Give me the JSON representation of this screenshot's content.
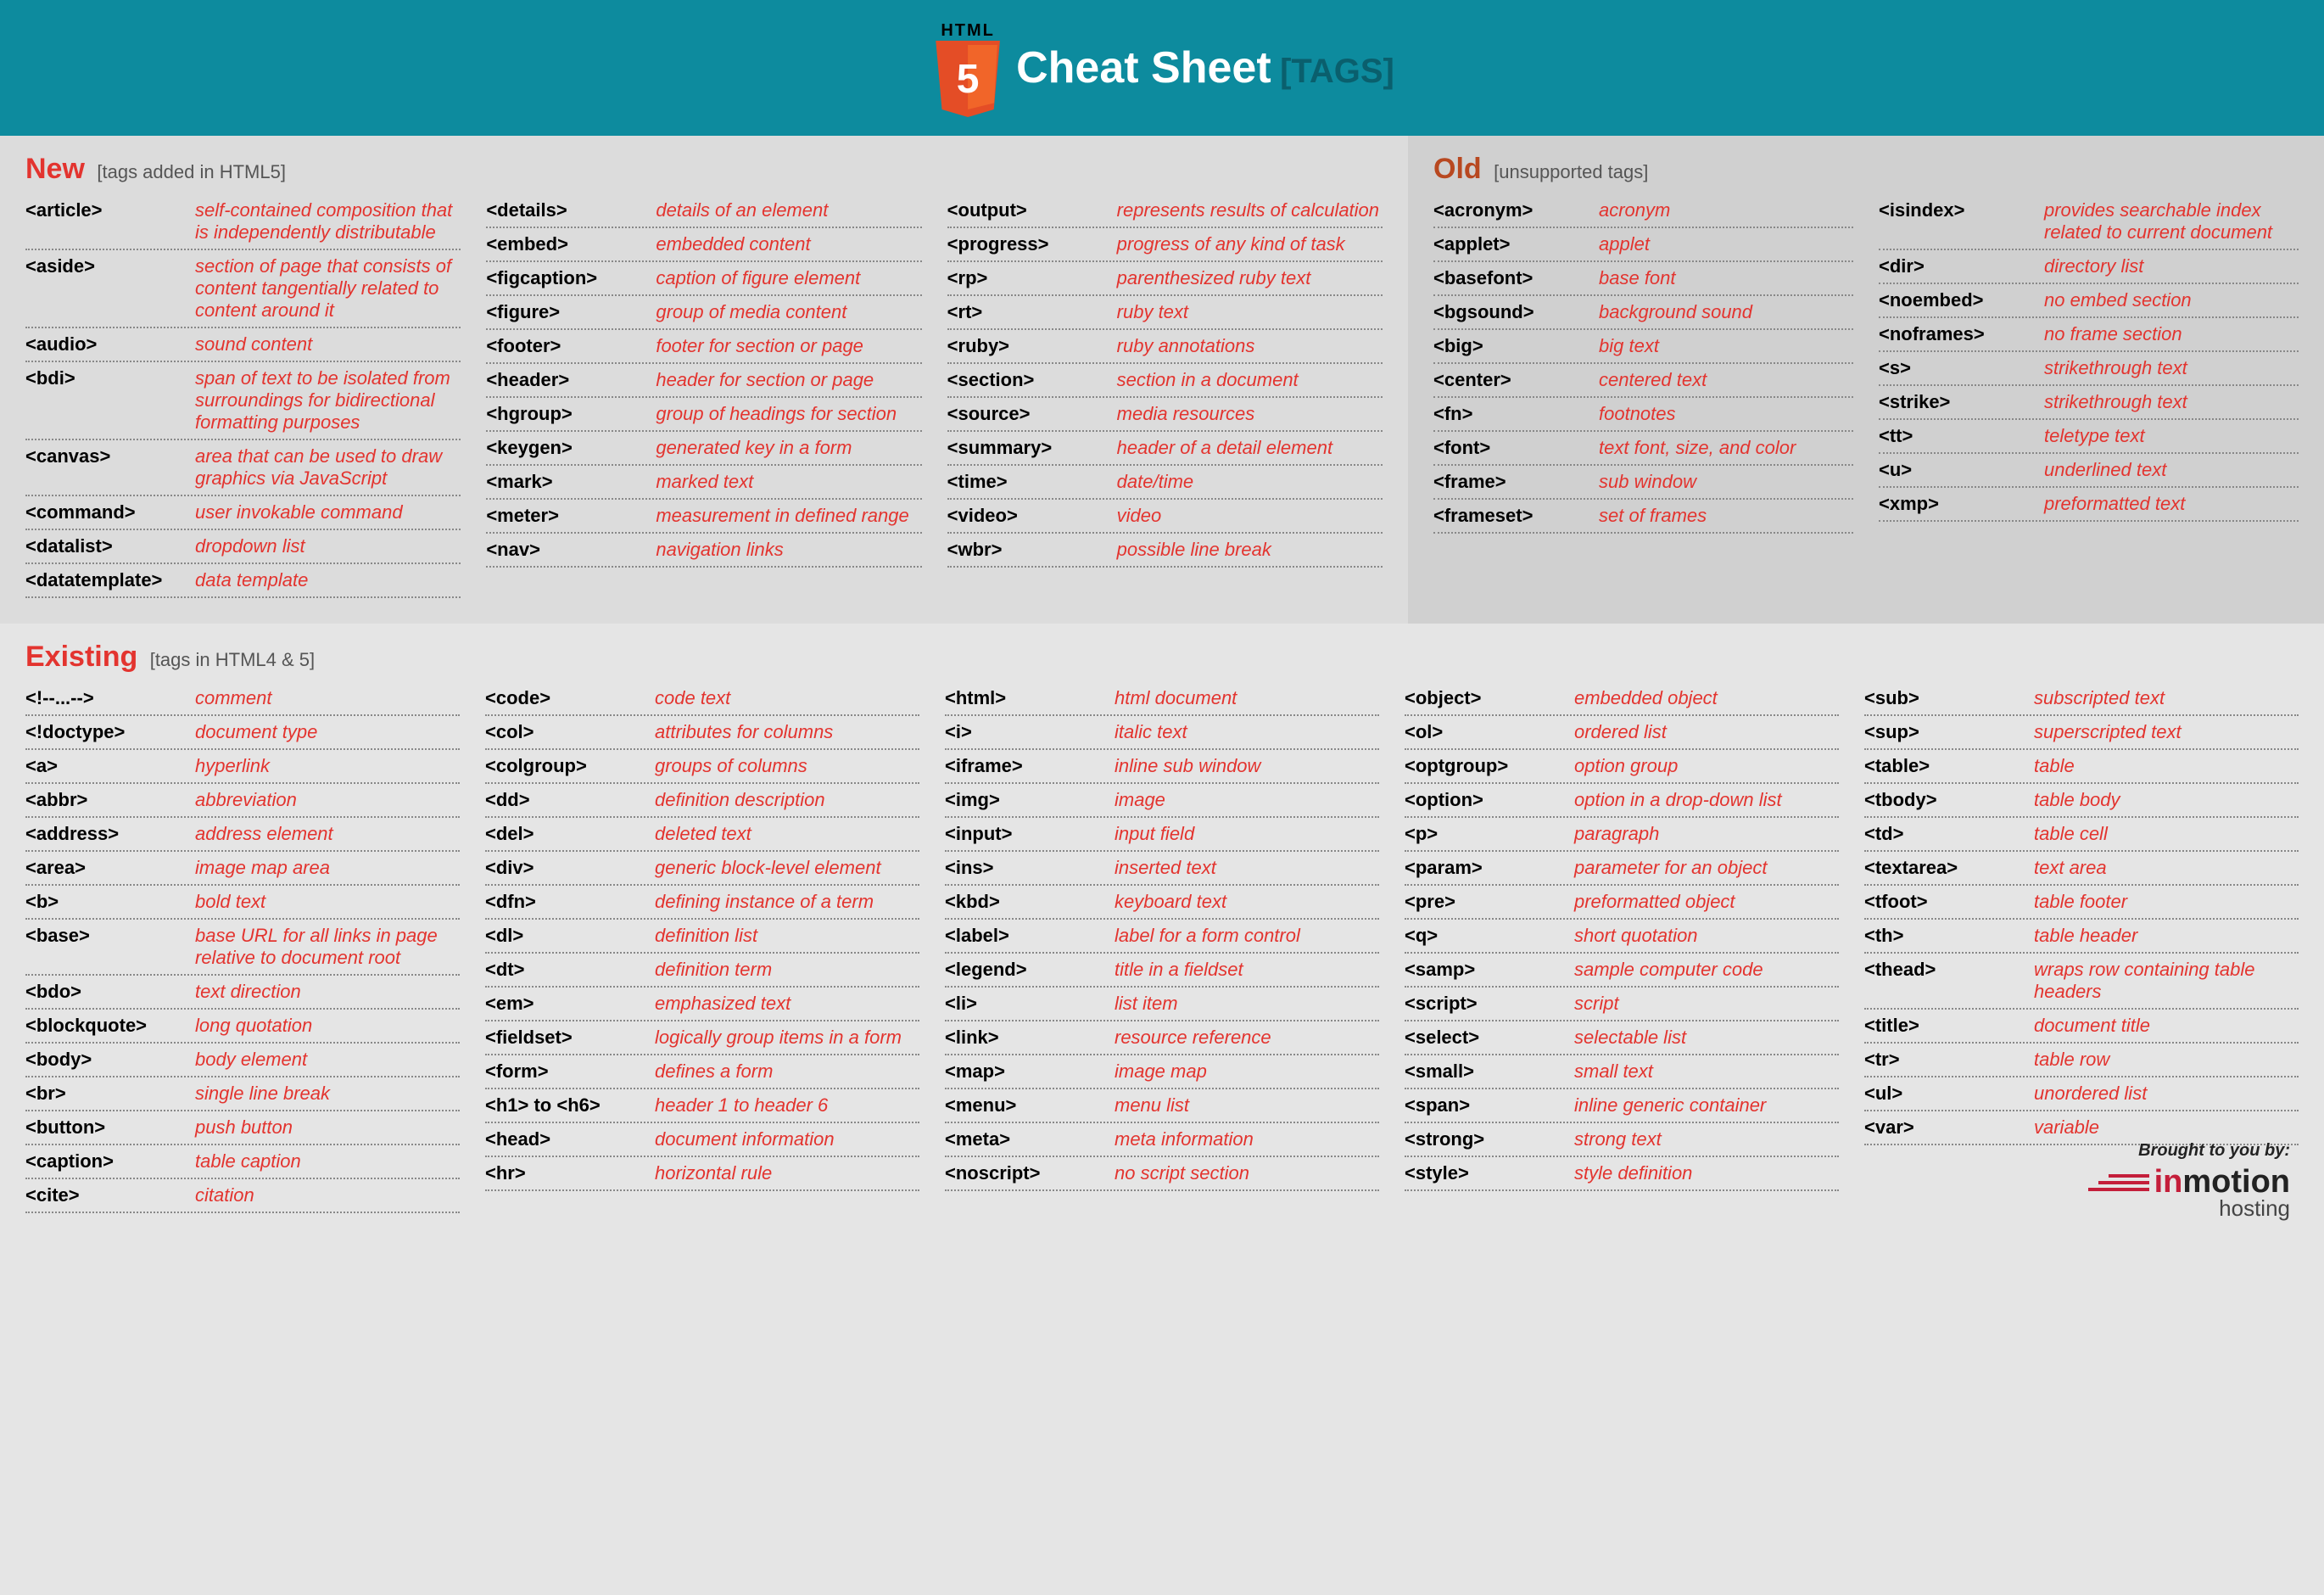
{
  "header": {
    "badge_top": "HTML",
    "badge_num": "5",
    "title": "Cheat Sheet",
    "subtitle": "[TAGS]"
  },
  "sections": {
    "new": {
      "title": "New",
      "subtitle": "[tags added in HTML5]",
      "columns": [
        [
          {
            "tag": "<article>",
            "desc": "self-contained composition that is independently distributable"
          },
          {
            "tag": "<aside>",
            "desc": "section of page that consists of content tangentially related to content around it"
          },
          {
            "tag": "<audio>",
            "desc": "sound content"
          },
          {
            "tag": "<bdi>",
            "desc": "span of text to be isolated from surroundings for bidirectional formatting purposes"
          },
          {
            "tag": "<canvas>",
            "desc": "area that can be used to draw graphics via JavaScript"
          },
          {
            "tag": "<command>",
            "desc": "user invokable command"
          },
          {
            "tag": "<datalist>",
            "desc": "dropdown list"
          },
          {
            "tag": "<datatemplate>",
            "desc": "data template"
          }
        ],
        [
          {
            "tag": "<details>",
            "desc": "details of an element"
          },
          {
            "tag": "<embed>",
            "desc": "embedded content"
          },
          {
            "tag": "<figcaption>",
            "desc": "caption of figure element"
          },
          {
            "tag": "<figure>",
            "desc": "group of media content"
          },
          {
            "tag": "<footer>",
            "desc": "footer for section or page"
          },
          {
            "tag": "<header>",
            "desc": "header for section or page"
          },
          {
            "tag": "<hgroup>",
            "desc": "group of headings for section"
          },
          {
            "tag": "<keygen>",
            "desc": "generated key in a form"
          },
          {
            "tag": "<mark>",
            "desc": "marked text"
          },
          {
            "tag": "<meter>",
            "desc": "measurement in defined range"
          },
          {
            "tag": "<nav>",
            "desc": "navigation links"
          }
        ],
        [
          {
            "tag": "<output>",
            "desc": "represents results of calculation"
          },
          {
            "tag": "<progress>",
            "desc": "progress of any kind of task"
          },
          {
            "tag": "<rp>",
            "desc": "parenthesized ruby text"
          },
          {
            "tag": "<rt>",
            "desc": "ruby text"
          },
          {
            "tag": "<ruby>",
            "desc": "ruby annotations"
          },
          {
            "tag": "<section>",
            "desc": "section in a document"
          },
          {
            "tag": "<source>",
            "desc": "media resources"
          },
          {
            "tag": "<summary>",
            "desc": "header of a detail element"
          },
          {
            "tag": "<time>",
            "desc": "date/time"
          },
          {
            "tag": "<video>",
            "desc": "video"
          },
          {
            "tag": "<wbr>",
            "desc": "possible line break"
          }
        ]
      ]
    },
    "old": {
      "title": "Old",
      "subtitle": "[unsupported tags]",
      "columns": [
        [
          {
            "tag": "<acronym>",
            "desc": "acronym"
          },
          {
            "tag": "<applet>",
            "desc": "applet"
          },
          {
            "tag": "<basefont>",
            "desc": "base font"
          },
          {
            "tag": "<bgsound>",
            "desc": "background sound"
          },
          {
            "tag": "<big>",
            "desc": "big text"
          },
          {
            "tag": "<center>",
            "desc": "centered text"
          },
          {
            "tag": "<fn>",
            "desc": "footnotes"
          },
          {
            "tag": "<font>",
            "desc": "text font, size, and color"
          },
          {
            "tag": "<frame>",
            "desc": "sub window"
          },
          {
            "tag": "<frameset>",
            "desc": "set of frames"
          }
        ],
        [
          {
            "tag": "<isindex>",
            "desc": "provides searchable index related to current document"
          },
          {
            "tag": "<dir>",
            "desc": "directory list"
          },
          {
            "tag": "<noembed>",
            "desc": "no embed section"
          },
          {
            "tag": "<noframes>",
            "desc": "no frame section"
          },
          {
            "tag": "<s>",
            "desc": "strikethrough text"
          },
          {
            "tag": "<strike>",
            "desc": "strikethrough text"
          },
          {
            "tag": "<tt>",
            "desc": "teletype text"
          },
          {
            "tag": "<u>",
            "desc": "underlined text"
          },
          {
            "tag": "<xmp>",
            "desc": "preformatted text"
          }
        ]
      ]
    },
    "existing": {
      "title": "Existing",
      "subtitle": "[tags in HTML4 & 5]",
      "columns": [
        [
          {
            "tag": "<!--...-->",
            "desc": "comment"
          },
          {
            "tag": "<!doctype>",
            "desc": "document type"
          },
          {
            "tag": "<a>",
            "desc": "hyperlink"
          },
          {
            "tag": "<abbr>",
            "desc": "abbreviation"
          },
          {
            "tag": "<address>",
            "desc": "address element"
          },
          {
            "tag": "<area>",
            "desc": "image map area"
          },
          {
            "tag": "<b>",
            "desc": "bold text"
          },
          {
            "tag": "<base>",
            "desc": "base URL for all links in page relative to document root"
          },
          {
            "tag": "<bdo>",
            "desc": "text direction"
          },
          {
            "tag": "<blockquote>",
            "desc": "long quotation"
          },
          {
            "tag": "<body>",
            "desc": "body element"
          },
          {
            "tag": "<br>",
            "desc": "single line break"
          },
          {
            "tag": "<button>",
            "desc": "push button"
          },
          {
            "tag": "<caption>",
            "desc": "table caption"
          },
          {
            "tag": "<cite>",
            "desc": "citation"
          }
        ],
        [
          {
            "tag": "<code>",
            "desc": "code text"
          },
          {
            "tag": "<col>",
            "desc": "attributes for columns"
          },
          {
            "tag": "<colgroup>",
            "desc": "groups of columns"
          },
          {
            "tag": "<dd>",
            "desc": "definition description"
          },
          {
            "tag": "<del>",
            "desc": "deleted text"
          },
          {
            "tag": "<div>",
            "desc": "generic block-level element"
          },
          {
            "tag": "<dfn>",
            "desc": "defining instance of a term"
          },
          {
            "tag": "<dl>",
            "desc": "definition list"
          },
          {
            "tag": "<dt>",
            "desc": "definition term"
          },
          {
            "tag": "<em>",
            "desc": "emphasized text"
          },
          {
            "tag": "<fieldset>",
            "desc": "logically group items in a form"
          },
          {
            "tag": "<form>",
            "desc": "defines a form"
          },
          {
            "tag": "<h1> to <h6>",
            "desc": "header 1 to header 6"
          },
          {
            "tag": "<head>",
            "desc": "document information"
          },
          {
            "tag": "<hr>",
            "desc": "horizontal rule"
          }
        ],
        [
          {
            "tag": "<html>",
            "desc": "html document"
          },
          {
            "tag": "<i>",
            "desc": "italic text"
          },
          {
            "tag": "<iframe>",
            "desc": "inline sub window"
          },
          {
            "tag": "<img>",
            "desc": "image"
          },
          {
            "tag": "<input>",
            "desc": "input field"
          },
          {
            "tag": "<ins>",
            "desc": "inserted text"
          },
          {
            "tag": "<kbd>",
            "desc": "keyboard text"
          },
          {
            "tag": "<label>",
            "desc": "label for a form control"
          },
          {
            "tag": "<legend>",
            "desc": "title in a fieldset"
          },
          {
            "tag": "<li>",
            "desc": "list item"
          },
          {
            "tag": "<link>",
            "desc": "resource reference"
          },
          {
            "tag": "<map>",
            "desc": "image map"
          },
          {
            "tag": "<menu>",
            "desc": "menu list"
          },
          {
            "tag": "<meta>",
            "desc": "meta information"
          },
          {
            "tag": "<noscript>",
            "desc": "no script section"
          }
        ],
        [
          {
            "tag": "<object>",
            "desc": "embedded object"
          },
          {
            "tag": "<ol>",
            "desc": "ordered list"
          },
          {
            "tag": "<optgroup>",
            "desc": "option group"
          },
          {
            "tag": "<option>",
            "desc": "option in a drop-down list"
          },
          {
            "tag": "<p>",
            "desc": "paragraph"
          },
          {
            "tag": "<param>",
            "desc": "parameter for an object"
          },
          {
            "tag": "<pre>",
            "desc": "preformatted object"
          },
          {
            "tag": "<q>",
            "desc": "short quotation"
          },
          {
            "tag": "<samp>",
            "desc": "sample computer code"
          },
          {
            "tag": "<script>",
            "desc": "script"
          },
          {
            "tag": "<select>",
            "desc": "selectable list"
          },
          {
            "tag": "<small>",
            "desc": "small text"
          },
          {
            "tag": "<span>",
            "desc": "inline generic container"
          },
          {
            "tag": "<strong>",
            "desc": "strong text"
          },
          {
            "tag": "<style>",
            "desc": "style definition"
          }
        ],
        [
          {
            "tag": "<sub>",
            "desc": "subscripted text"
          },
          {
            "tag": "<sup>",
            "desc": "superscripted text"
          },
          {
            "tag": "<table>",
            "desc": "table"
          },
          {
            "tag": "<tbody>",
            "desc": "table body"
          },
          {
            "tag": "<td>",
            "desc": "table cell"
          },
          {
            "tag": "<textarea>",
            "desc": "text area"
          },
          {
            "tag": "<tfoot>",
            "desc": "table footer"
          },
          {
            "tag": "<th>",
            "desc": "table header"
          },
          {
            "tag": "<thead>",
            "desc": "wraps row containing table headers"
          },
          {
            "tag": "<title>",
            "desc": "document title"
          },
          {
            "tag": "<tr>",
            "desc": "table row"
          },
          {
            "tag": "<ul>",
            "desc": "unordered list"
          },
          {
            "tag": "<var>",
            "desc": "variable"
          }
        ]
      ]
    }
  },
  "footer": {
    "brought": "Brought to you by:",
    "brand_in": "in",
    "brand_motion": "motion",
    "brand_hosting": "hosting"
  }
}
